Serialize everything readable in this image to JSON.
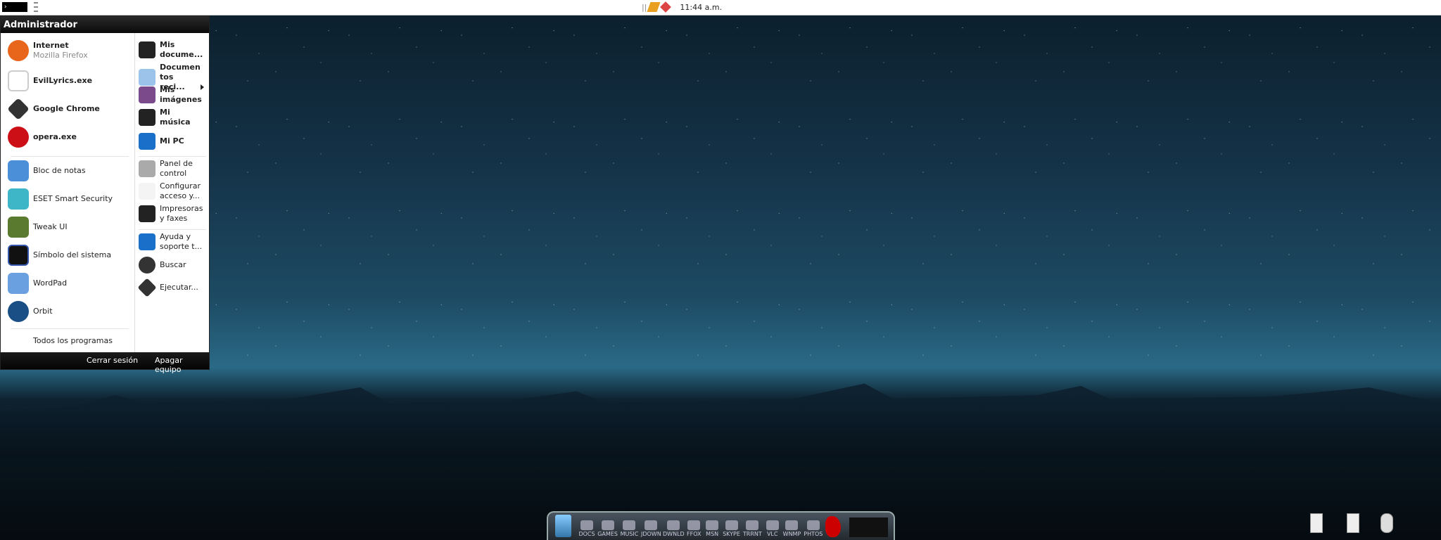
{
  "topbar": {
    "start_label": "›",
    "clock": "11:44 a.m.",
    "tray_icons": [
      "winamp-icon",
      "antivirus-icon"
    ]
  },
  "menu": {
    "user": "Administrador",
    "left_pinned": [
      {
        "label": "Internet",
        "sub": "Mozilla Firefox",
        "icon": "firefox-icon",
        "color": "#e8661b"
      },
      {
        "label": "EvilLyrics.exe",
        "icon": "evillyrics-icon",
        "color": "#cccccc"
      },
      {
        "label": "Google Chrome",
        "icon": "chrome-icon",
        "color": "#333333"
      },
      {
        "label": "opera.exe",
        "icon": "opera-icon",
        "color": "#cc0f16"
      }
    ],
    "left_recent": [
      {
        "label": "Bloc de notas",
        "icon": "notepad-icon",
        "color": "#4a8fd8"
      },
      {
        "label": "ESET Smart Security",
        "icon": "eset-icon",
        "color": "#3fb6c8"
      },
      {
        "label": "Tweak UI",
        "icon": "tweakui-icon",
        "color": "#5a7a30"
      },
      {
        "label": "Símbolo del sistema",
        "icon": "cmd-icon",
        "color": "#111111"
      },
      {
        "label": "WordPad",
        "icon": "wordpad-icon",
        "color": "#6aa0e0"
      },
      {
        "label": "Orbit",
        "icon": "orbit-icon",
        "color": "#1a4f86"
      }
    ],
    "all_programs": "Todos los programas",
    "right_top": [
      {
        "label": "Mis docume...",
        "icon": "documents-icon",
        "color": "#222222"
      },
      {
        "label": "Documen tos reci...",
        "icon": "recent-documents-icon",
        "color": "#9cc4ea"
      },
      {
        "label": "Mis imágenes",
        "icon": "pictures-icon",
        "color": "#7a4a8a"
      },
      {
        "label": "Mi música",
        "icon": "music-icon",
        "color": "#222222"
      },
      {
        "label": "Mi PC",
        "icon": "my-computer-icon",
        "color": "#1a70c8"
      }
    ],
    "right_mid": [
      {
        "label": "Panel de control",
        "icon": "control-panel-icon",
        "color": "#aaaaaa"
      },
      {
        "label": "Configurar acceso y...",
        "icon": "program-access-icon",
        "color": "#eeeeee"
      },
      {
        "label": "Impresoras y faxes",
        "icon": "printer-icon",
        "color": "#222222"
      }
    ],
    "right_bottom": [
      {
        "label": "Ayuda y soporte t...",
        "icon": "help-icon",
        "color": "#1a70c8"
      },
      {
        "label": "Buscar",
        "icon": "search-icon",
        "color": "#333333"
      },
      {
        "label": "Ejecutar...",
        "icon": "run-icon",
        "color": "#333333"
      }
    ],
    "logoff": "Cerrar sesión",
    "shutdown": "Apagar equipo"
  },
  "dock": {
    "items": [
      "DOCS",
      "GAMES",
      "MUSIC",
      "JDOWN",
      "DWNLD",
      "FFOX",
      "MSN",
      "SKYPE",
      "TRRNT",
      "VLC",
      "WNMP",
      "PHTOS"
    ]
  }
}
